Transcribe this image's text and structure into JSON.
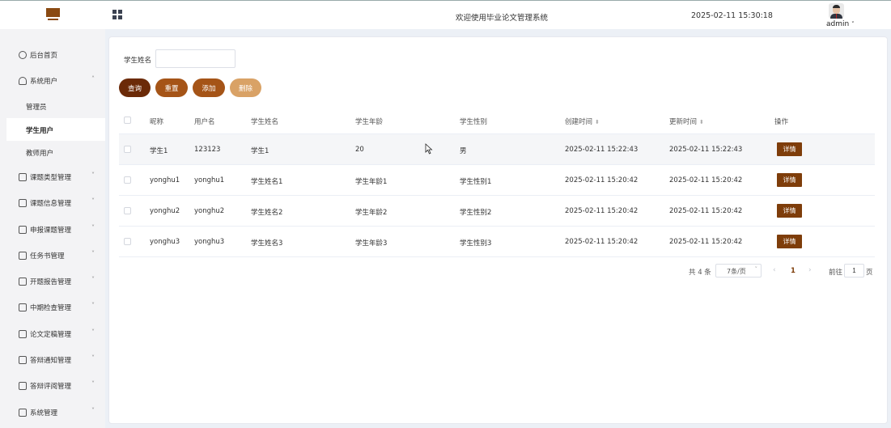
{
  "header": {
    "title": "欢迎使用毕业论文管理系统",
    "datetime": "2025-02-11 15:30:18",
    "user": "admin"
  },
  "sidebar": {
    "items": [
      {
        "label": "后台首页",
        "icon": "clock-icon"
      },
      {
        "label": "系统用户",
        "icon": "user-icon",
        "expanded": true,
        "children": [
          "管理员",
          "学生用户",
          "教师用户"
        ],
        "active_child": "学生用户"
      },
      {
        "label": "课题类型管理",
        "icon": "list-icon"
      },
      {
        "label": "课题信息管理",
        "icon": "list-icon"
      },
      {
        "label": "申报课题管理",
        "icon": "list-icon"
      },
      {
        "label": "任务书管理",
        "icon": "list-icon"
      },
      {
        "label": "开题报告管理",
        "icon": "list-icon"
      },
      {
        "label": "中期检查管理",
        "icon": "list-icon"
      },
      {
        "label": "论文定稿管理",
        "icon": "list-icon"
      },
      {
        "label": "答辩通知管理",
        "icon": "list-icon"
      },
      {
        "label": "答辩评阅管理",
        "icon": "list-icon"
      },
      {
        "label": "系统管理",
        "icon": "folder-icon"
      }
    ]
  },
  "search": {
    "label": "学生姓名",
    "value": "",
    "placeholder": ""
  },
  "buttons": {
    "query": "查询",
    "reset": "重置",
    "add": "添加",
    "delete": "删除"
  },
  "table": {
    "columns": [
      "昵称",
      "用户名",
      "学生姓名",
      "学生年龄",
      "学生性别",
      "创建时间",
      "更新时间",
      "操作"
    ],
    "rows": [
      {
        "nickname": "学生1",
        "username": "123123",
        "name": "学生1",
        "age": "20",
        "gender": "男",
        "created": "2025-02-11 15:22:43",
        "updated": "2025-02-11 15:22:43",
        "action": "详情"
      },
      {
        "nickname": "yonghu1",
        "username": "yonghu1",
        "name": "学生姓名1",
        "age": "学生年龄1",
        "gender": "学生性别1",
        "created": "2025-02-11 15:20:42",
        "updated": "2025-02-11 15:20:42",
        "action": "详情"
      },
      {
        "nickname": "yonghu2",
        "username": "yonghu2",
        "name": "学生姓名2",
        "age": "学生年龄2",
        "gender": "学生性别2",
        "created": "2025-02-11 15:20:42",
        "updated": "2025-02-11 15:20:42",
        "action": "详情"
      },
      {
        "nickname": "yonghu3",
        "username": "yonghu3",
        "name": "学生姓名3",
        "age": "学生年龄3",
        "gender": "学生性别3",
        "created": "2025-02-11 15:20:42",
        "updated": "2025-02-11 15:20:42",
        "action": "详情"
      }
    ]
  },
  "pager": {
    "total": "共 4 条",
    "page_size": "7条/页",
    "current_page": "1",
    "goto_label": "前往",
    "goto_value": "1",
    "goto_unit": "页"
  },
  "colors": {
    "primary_dark": "#6b2a08",
    "primary": "#a55417",
    "primary_light": "#d9a266",
    "detail": "#7e3d0a"
  }
}
